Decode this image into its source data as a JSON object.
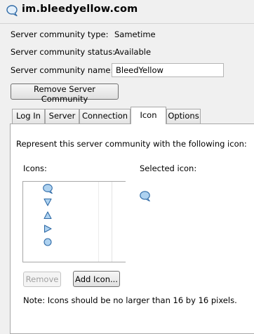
{
  "window": {
    "title": "im.bleedyellow.com",
    "icon": "speech-bubble-icon"
  },
  "fields": {
    "type_label": "Server community type:",
    "type_value": "Sametime",
    "status_label": "Server community status:",
    "status_value": "Available",
    "name_label": "Server community name:",
    "name_value": "BleedYellow"
  },
  "buttons": {
    "remove_community": "Remove Server Community",
    "remove": "Remove",
    "add_icon": "Add Icon..."
  },
  "tabs": [
    {
      "label": "Log In",
      "active": false
    },
    {
      "label": "Server",
      "active": false
    },
    {
      "label": "Connection",
      "active": false
    },
    {
      "label": "Icon",
      "active": true
    },
    {
      "label": "Options",
      "active": false
    }
  ],
  "icon_tab": {
    "description": "Represent this server community with the following icon:",
    "icons_label": "Icons:",
    "selected_label": "Selected icon:",
    "icons": [
      "speech-bubble-icon",
      "triangle-down-icon",
      "triangle-up-icon",
      "triangle-right-icon",
      "circle-icon"
    ],
    "selected_icon": "speech-bubble-icon",
    "note": "Note: Icons should be no larger than 16 by 16 pixels."
  },
  "colors": {
    "icon_fill": "#aed2f0",
    "icon_stroke": "#2f6aa6"
  }
}
